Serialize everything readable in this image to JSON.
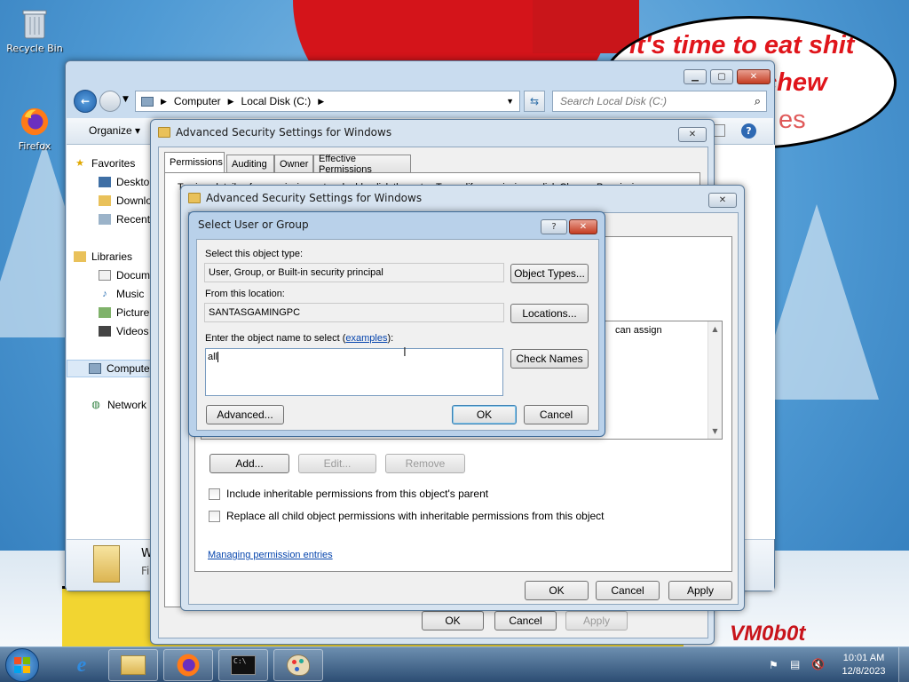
{
  "desktop": {
    "icons": [
      {
        "label": "Recycle Bin",
        "icon": "recycle-bin-icon"
      },
      {
        "label": "Firefox",
        "icon": "firefox-icon"
      }
    ],
    "wallpaper": {
      "bubble_lines": [
        "it's time to eat shit",
        "chew",
        "es"
      ],
      "signature": "VM0b0t"
    }
  },
  "explorer": {
    "breadcrumb": [
      "Computer",
      "Local Disk (C:)"
    ],
    "search_placeholder": "Search Local Disk (C:)",
    "organize_label": "Organize",
    "nav_items": [
      {
        "label": "Favorites",
        "icon": "star-icon"
      },
      {
        "label": "Deskto",
        "icon": "desktop-icon"
      },
      {
        "label": "Downlo",
        "icon": "downloads-icon"
      },
      {
        "label": "Recent",
        "icon": "recent-icon"
      },
      {
        "label": "Libraries",
        "icon": "library-icon"
      },
      {
        "label": "Docum",
        "icon": "document-icon"
      },
      {
        "label": "Music",
        "icon": "music-icon"
      },
      {
        "label": "Picture",
        "icon": "picture-icon"
      },
      {
        "label": "Videos",
        "icon": "video-icon"
      },
      {
        "label": "Compute",
        "icon": "computer-icon"
      },
      {
        "label": "Network",
        "icon": "network-icon"
      }
    ],
    "details_name": "Window",
    "details_type": "File folde"
  },
  "adv_security_back": {
    "title": "Advanced Security Settings for Windows",
    "tabs": [
      "Permissions",
      "Auditing",
      "Owner",
      "Effective Permissions"
    ],
    "text_fragment": "To view details of a permission entry, double-click the entry. To modify permissions, click Change Permissions.",
    "ok_label": "OK",
    "cancel_label": "Cancel",
    "apply_label": "Apply"
  },
  "adv_security_front": {
    "title": "Advanced Security Settings for Windows",
    "list_header_fragment": "can assign",
    "add_label": "Add...",
    "edit_label": "Edit...",
    "remove_label": "Remove",
    "include_inheritable_label": "Include inheritable permissions from this object's parent",
    "replace_child_label": "Replace all child object permissions with inheritable permissions from this object",
    "managing_link": "Managing permission entries",
    "ok_label": "OK",
    "cancel_label": "Cancel",
    "apply_label": "Apply"
  },
  "select_user": {
    "title": "Select User or Group",
    "object_type_label": "Select this object type:",
    "object_type_value": "User, Group, or Built-in security principal",
    "object_types_button": "Object Types...",
    "location_label": "From this location:",
    "location_value": "SANTASGAMINGPC",
    "locations_button": "Locations...",
    "enter_label_prefix": "Enter the object name to select (",
    "examples_link": "examples",
    "enter_label_suffix": "):",
    "object_name_value": "all",
    "check_names_button": "Check Names",
    "advanced_button": "Advanced...",
    "ok_button": "OK",
    "cancel_button": "Cancel",
    "help_label": "?",
    "close_label": "✕"
  },
  "taskbar": {
    "apps": [
      "internet-explorer-icon",
      "file-explorer-icon",
      "firefox-icon",
      "command-prompt-icon",
      "paint-icon"
    ],
    "time": "10:01 AM",
    "date": "12/8/2023"
  }
}
